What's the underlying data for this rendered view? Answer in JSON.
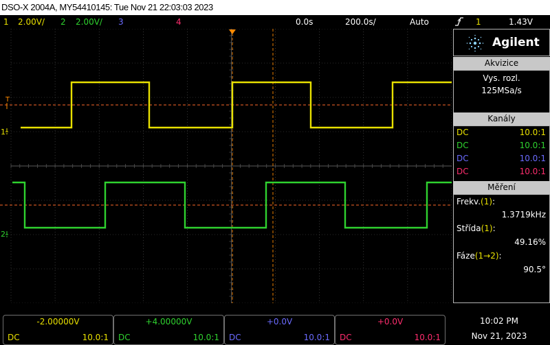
{
  "window": {
    "title": "DSO-X 2004A, MY54410145: Tue Nov 21 22:03:03 2023"
  },
  "status": {
    "ch1_num": "1",
    "ch1_scale": "2.00V/",
    "ch2_num": "2",
    "ch2_scale": "2.00V/",
    "ch3_num": "3",
    "ch4_num": "4",
    "time_delay": "0.0s",
    "time_scale": "200.0s/",
    "trigger_mode": "Auto",
    "trigger_icon": "rising-edge-icon",
    "trigger_source": "1",
    "trigger_level": "1.43V"
  },
  "colors": {
    "ch1": "#e8e000",
    "ch2": "#2fd22f",
    "ch3": "#6b6bff",
    "ch4": "#ff2d6e",
    "trigger_marker": "#ff8a00",
    "grid": "#5a5a5a"
  },
  "sidebar": {
    "brand": "Agilent",
    "acquisition": {
      "title": "Akvizice",
      "mode": "Vys. rozl.",
      "rate": "125MSa/s"
    },
    "channels": {
      "title": "Kanály",
      "rows": [
        {
          "coupling": "DC",
          "probe": "10.0:1"
        },
        {
          "coupling": "DC",
          "probe": "10.0:1"
        },
        {
          "coupling": "DC",
          "probe": "10.0:1"
        },
        {
          "coupling": "DC",
          "probe": "10.0:1"
        }
      ]
    },
    "measurements": {
      "title": "Měření",
      "items": [
        {
          "label_pre": "Frekv.",
          "label_src": "(1)",
          "label_post": ":",
          "value": "1.3719kHz"
        },
        {
          "label_pre": "Střída",
          "label_src": "(1)",
          "label_post": ":",
          "value": "49.16%"
        },
        {
          "label_pre": "Fáze",
          "label_src": "(1→2)",
          "label_post": ":",
          "value": "90.5°"
        }
      ]
    }
  },
  "markers": {
    "ch1_ground": "1",
    "ch2_ground": "2",
    "trigger_level": "T"
  },
  "bottom": {
    "channels": [
      {
        "offset": "-2.00000V",
        "coupling": "DC",
        "probe": "10.0:1"
      },
      {
        "offset": "+4.00000V",
        "coupling": "DC",
        "probe": "10.0:1"
      },
      {
        "offset": "+0.0V",
        "coupling": "DC",
        "probe": "10.0:1"
      },
      {
        "offset": "+0.0V",
        "coupling": "DC",
        "probe": "10.0:1"
      }
    ],
    "clock": {
      "time": "10:02 PM",
      "date": "Nov 21, 2023"
    }
  }
}
